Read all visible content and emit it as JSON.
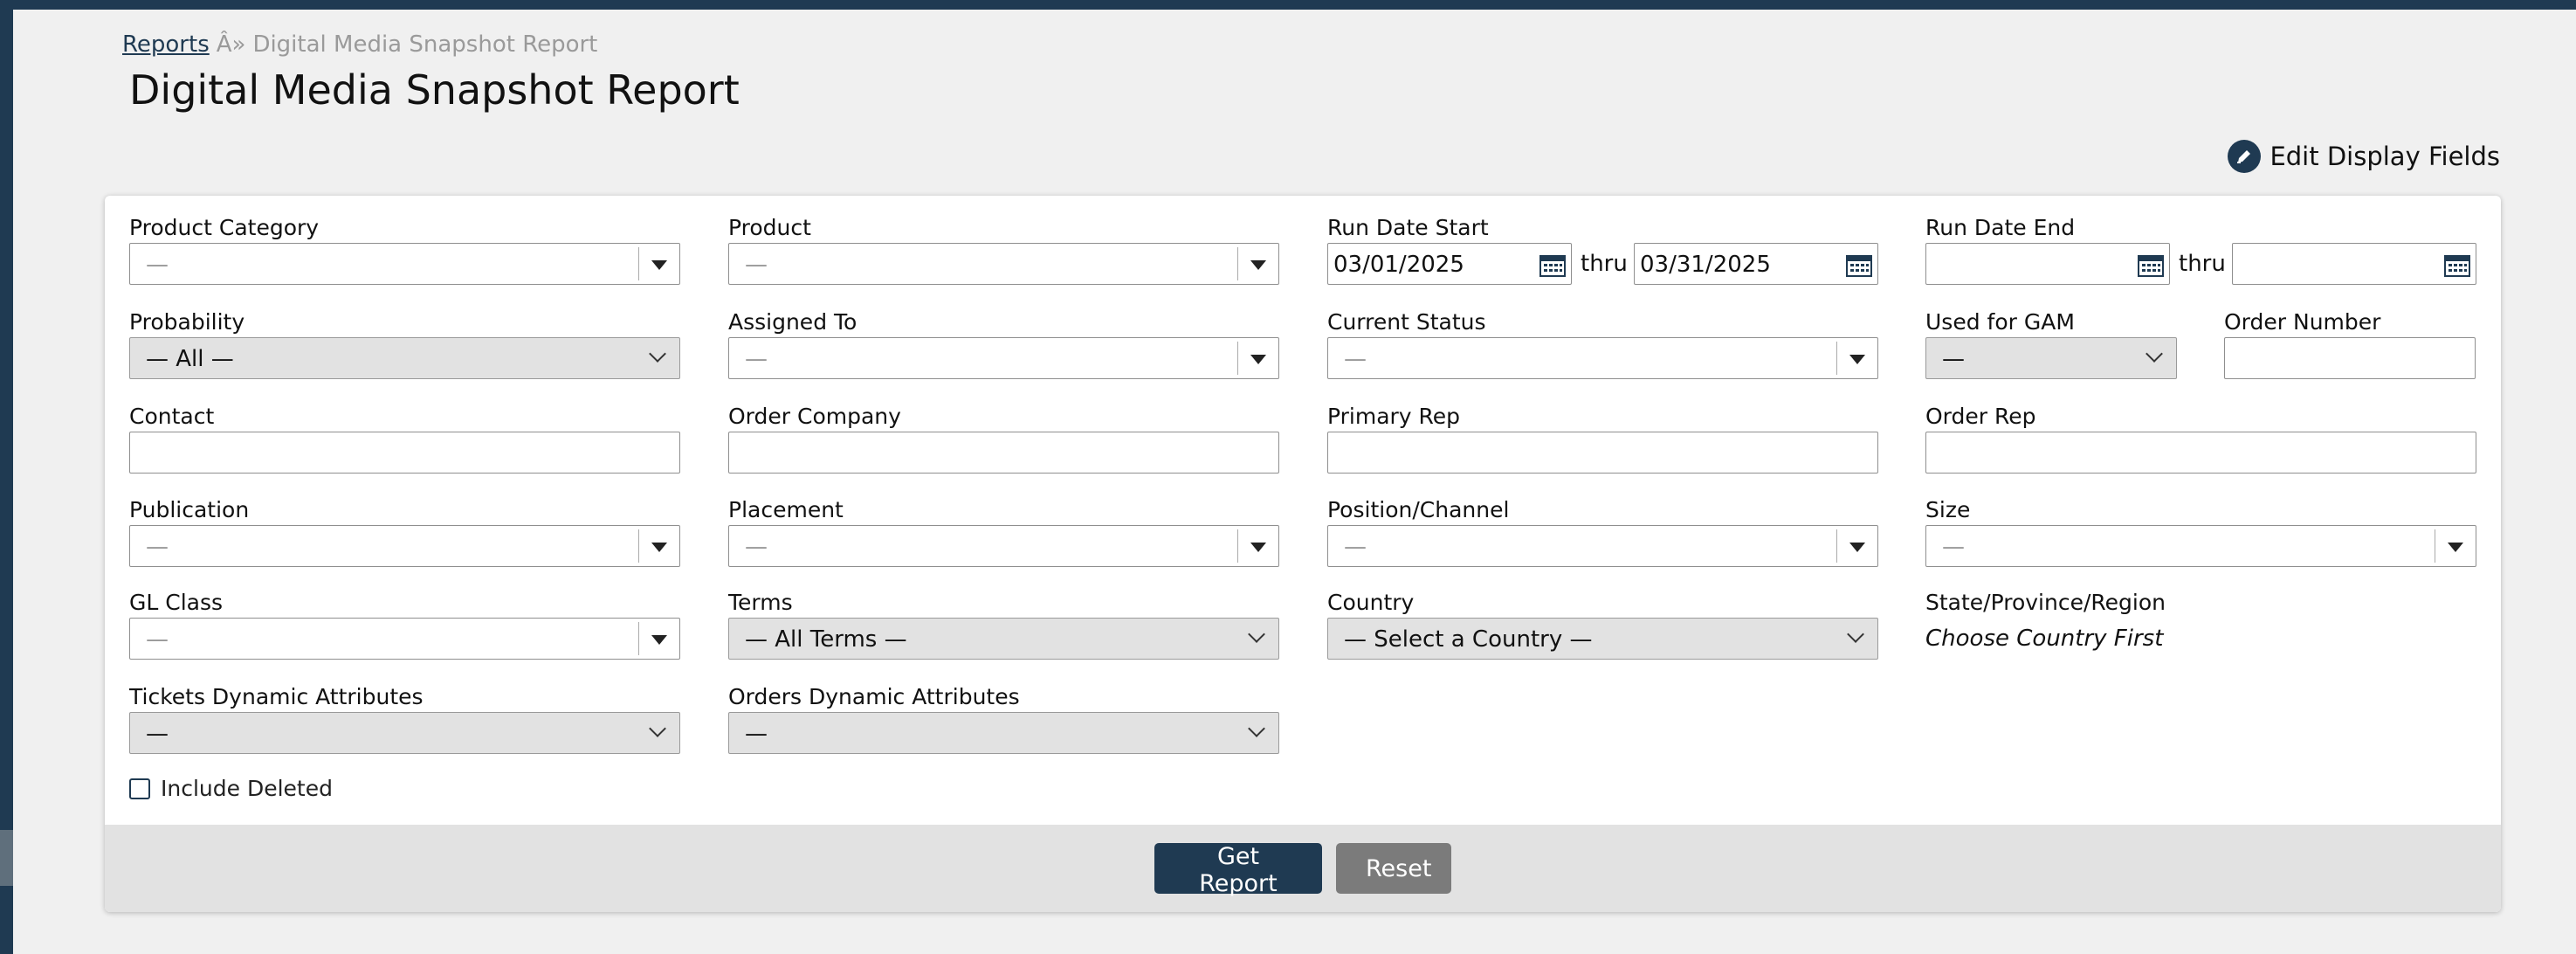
{
  "breadcrumb": {
    "root": "Reports",
    "separator": "Â»",
    "current": "Digital Media Snapshot Report"
  },
  "page": {
    "title": "Digital Media Snapshot Report",
    "edit_fields_label": "Edit Display Fields"
  },
  "colors": {
    "nav": "#1f3a52",
    "primary_button": "#1f3a52",
    "secondary_button": "#7b7b7b",
    "footer": "#e2e2e2"
  },
  "form": {
    "product_category": {
      "label": "Product Category",
      "value": "—"
    },
    "product": {
      "label": "Product",
      "value": "—"
    },
    "run_date_start": {
      "label": "Run Date Start",
      "from": "03/01/2025",
      "thru_label": "thru",
      "to": "03/31/2025"
    },
    "run_date_end": {
      "label": "Run Date End",
      "from": "",
      "thru_label": "thru",
      "to": ""
    },
    "probability": {
      "label": "Probability",
      "value": "— All —"
    },
    "assigned_to": {
      "label": "Assigned To",
      "value": "—"
    },
    "current_status": {
      "label": "Current Status",
      "value": "—"
    },
    "used_for_gam": {
      "label": "Used for GAM",
      "value": "—"
    },
    "order_number": {
      "label": "Order Number",
      "value": ""
    },
    "contact": {
      "label": "Contact",
      "value": ""
    },
    "order_company": {
      "label": "Order Company",
      "value": ""
    },
    "primary_rep": {
      "label": "Primary Rep",
      "value": ""
    },
    "order_rep": {
      "label": "Order Rep",
      "value": ""
    },
    "publication": {
      "label": "Publication",
      "value": "—"
    },
    "placement": {
      "label": "Placement",
      "value": "—"
    },
    "position_channel": {
      "label": "Position/Channel",
      "value": "—"
    },
    "size": {
      "label": "Size",
      "value": "—"
    },
    "gl_class": {
      "label": "GL Class",
      "value": "—"
    },
    "terms": {
      "label": "Terms",
      "value": "— All Terms —"
    },
    "country": {
      "label": "Country",
      "value": "— Select a Country —"
    },
    "state": {
      "label": "State/Province/Region",
      "note": "Choose Country First"
    },
    "tickets_dynamic": {
      "label": "Tickets Dynamic Attributes",
      "value": "—"
    },
    "orders_dynamic": {
      "label": "Orders Dynamic Attributes",
      "value": "—"
    },
    "include_deleted": {
      "label": "Include Deleted",
      "checked": false
    }
  },
  "buttons": {
    "get_report": "Get Report",
    "reset": "Reset"
  }
}
